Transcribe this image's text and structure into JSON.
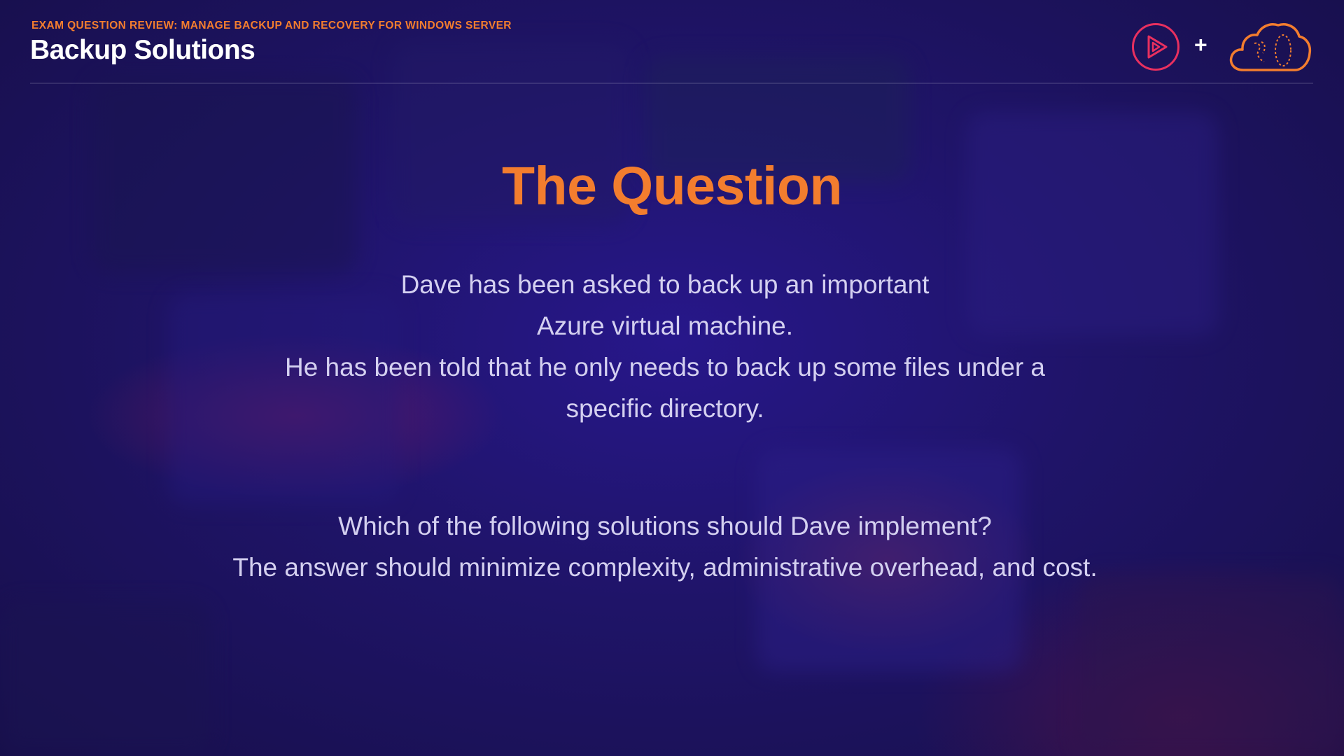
{
  "header": {
    "kicker": "EXAM QUESTION REVIEW: MANAGE BACKUP AND RECOVERY FOR WINDOWS SERVER",
    "title": "Backup Solutions",
    "plus_sign": "+"
  },
  "logos": {
    "left": "play-icon",
    "right": "cloud-icon"
  },
  "slide": {
    "heading": "The Question",
    "scenario_lines": [
      "Dave has been asked to back up an important",
      "Azure virtual machine.",
      "He has been told that he only needs to back up some files under a",
      "specific directory."
    ],
    "question_lines": [
      "Which of the following solutions should Dave implement?",
      "The answer should minimize complexity, administrative overhead, and cost."
    ]
  },
  "colors": {
    "accent": "#f37d2e",
    "logo_pink": "#e8305f",
    "body_text": "#d4d0f0",
    "background": "#1f1468"
  }
}
